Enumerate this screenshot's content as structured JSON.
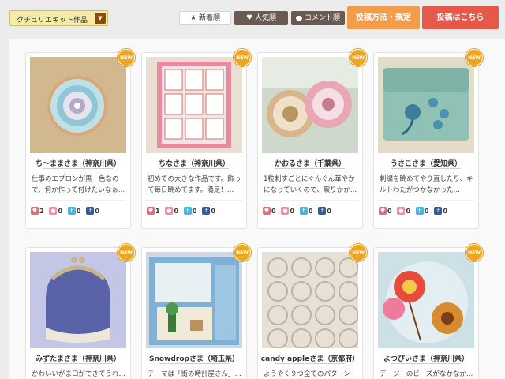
{
  "topbar": {
    "category": "クチュリエキット作品",
    "sort_new": "新着順",
    "sort_popular": "人気順",
    "sort_comments": "コメント順",
    "rules_button": "投稿方法・規定",
    "post_button": "投稿はこちら"
  },
  "badge": "NEW",
  "cards": [
    {
      "author": "ち～ままさま（神奈川県）",
      "desc": "仕事のエプロンが黒一色なので、何か作って付けたいなぁ…",
      "likes": "2",
      "comments": "0",
      "tweets": "0",
      "shares": "0"
    },
    {
      "author": "ちなさま（神奈川県）",
      "desc": "初めての大きな作品です。飾って毎日眺めてます。満足！…",
      "likes": "1",
      "comments": "0",
      "tweets": "0",
      "shares": "0"
    },
    {
      "author": "かおるさま（千葉県）",
      "desc": "1粒刺すごとにぐんぐん華やかになっていくので、取りかか…",
      "likes": "0",
      "comments": "0",
      "tweets": "0",
      "shares": "0"
    },
    {
      "author": "うさこさま（愛知県）",
      "desc": "刺繍を眺めてやり直したり、キルトわたがつかなかった…",
      "likes": "0",
      "comments": "0",
      "tweets": "0",
      "shares": "0"
    },
    {
      "author": "みずたまさま（神奈川県）",
      "desc": "かわいいがま口ができてうれ…"
    },
    {
      "author": "Snowdropさま（埼玉県）",
      "desc": "テーマは「街の時計屋さん」…"
    },
    {
      "author": "candy appleさま（京都府）",
      "desc": "ようやく９つ全てのパターンが…"
    },
    {
      "author": "よつぴいさま（神奈川県）",
      "desc": "デージーのビーズがなかなか…"
    }
  ]
}
